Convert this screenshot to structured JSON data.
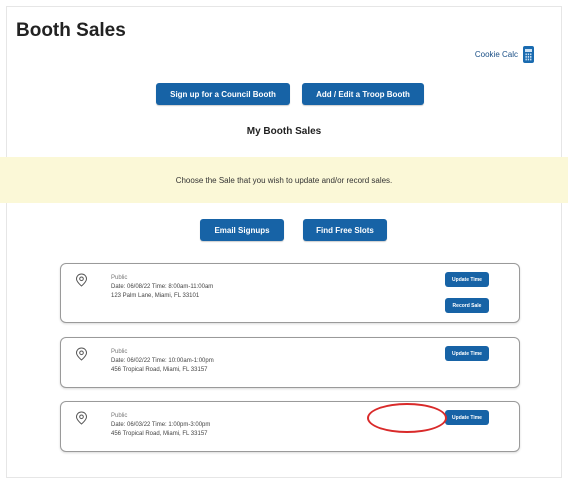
{
  "page": {
    "title": "Booth Sales",
    "subtitle": "My Booth Sales",
    "banner": "Choose the Sale that you wish to update and/or record sales."
  },
  "calc": {
    "label": "Cookie Calc",
    "icon": "calculator-icon"
  },
  "buttons": {
    "council": "Sign up for a Council Booth",
    "troop": "Add / Edit a Troop Booth",
    "email": "Email Signups",
    "slots": "Find Free Slots"
  },
  "sales": [
    {
      "type": "Public",
      "date_time": "Date: 06/08/22   Time: 8:00am-11:00am",
      "address": "123 Palm Lane, Miami, FL 33101",
      "actions": [
        "Update Time",
        "Record Sale"
      ]
    },
    {
      "type": "Public",
      "date_time": "Date: 06/02/22   Time: 10:00am-1:00pm",
      "address": "456 Tropical Road, Miami, FL 33157",
      "actions": [
        "Update Time"
      ]
    },
    {
      "type": "Public",
      "date_time": "Date: 06/03/22   Time: 1:00pm-3:00pm",
      "address": "456 Tropical Road, Miami, FL 33157",
      "actions": [
        "Update Time"
      ]
    }
  ],
  "colors": {
    "button": "#1763a6",
    "banner": "#fbf8d7",
    "highlight": "#d92a2a"
  }
}
